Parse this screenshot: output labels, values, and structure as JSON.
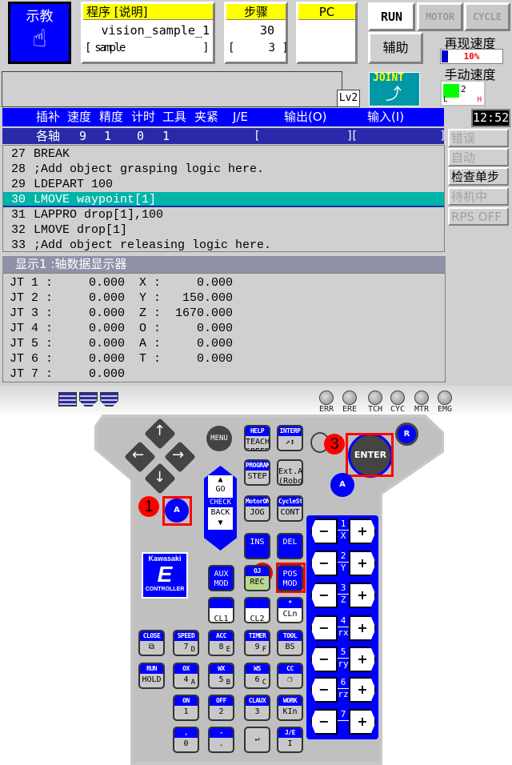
{
  "mode": {
    "label": "示教",
    "icon": "hand-pointer-icon"
  },
  "program": {
    "header": "程序 [说明]",
    "name": "vision_sample_1",
    "comment": "[ sample                ]"
  },
  "step": {
    "header": "步骤",
    "value": "30",
    "sub": "[     3 ]"
  },
  "pc": {
    "header": "PC",
    "value": ""
  },
  "status_buttons": [
    "RUN",
    "MOTOR",
    "CYCLE"
  ],
  "aux_label": "辅助",
  "repeat_speed": {
    "label": "再现速度",
    "value": "10%",
    "percent": 10
  },
  "manual_speed": {
    "label": "手动速度",
    "level": "2",
    "low": "L",
    "high": "H"
  },
  "level": "Lv2",
  "interp_mode": "JOINT",
  "clock": "12:52",
  "header_bar": [
    "插补",
    "速度",
    "精度",
    "计时",
    "工具",
    "夹紧",
    "J/E",
    "输出(O)",
    "输入(I)"
  ],
  "axis_bar": {
    "label": "各轴",
    "values": [
      "9",
      "1",
      "0",
      "1"
    ],
    "bracket": "[                    ][                   ]"
  },
  "program_lines": [
    {
      "num": "27",
      "text": "BREAK"
    },
    {
      "num": "28",
      "text": ";Add object grasping logic here."
    },
    {
      "num": "29",
      "text": "LDEPART 100"
    },
    {
      "num": "30",
      "text": "LMOVE waypoint[1]"
    },
    {
      "num": "31",
      "text": "LAPPRO drop[1],100"
    },
    {
      "num": "32",
      "text": "LMOVE drop[1]"
    },
    {
      "num": "33",
      "text": ";Add object releasing logic here."
    }
  ],
  "selected_line": "30",
  "side_status": [
    {
      "label": "错误",
      "active": false
    },
    {
      "label": "自动",
      "active": false
    },
    {
      "label": "检查单步",
      "active": true
    },
    {
      "label": "待机中",
      "active": false
    },
    {
      "label": "RPS OFF",
      "active": false
    }
  ],
  "display": {
    "title": "显示1 :轴数据显示器",
    "rows": [
      "JT 1 :     0.000  X :     0.000",
      "JT 2 :     0.000  Y :   150.000",
      "JT 3 :     0.000  Z :  1670.000",
      "JT 4 :     0.000  O :     0.000",
      "JT 5 :     0.000  A :     0.000",
      "JT 6 :     0.000  T :     0.000",
      "JT 7 :     0.000"
    ]
  },
  "lights": [
    "ERR",
    "ERE",
    "TCH",
    "CYC",
    "MTR",
    "EMG"
  ],
  "pendant": {
    "menu": "MENU",
    "go": "GO",
    "check": "CHECK",
    "back": "BACK",
    "enter": "ENTER",
    "r": "R",
    "a": "A",
    "logo": {
      "brand": "Kawasaki",
      "letter": "E",
      "sub": "CONTROLLER"
    },
    "keys": [
      {
        "top": "HELP",
        "main": "TEACH SPEED"
      },
      {
        "top": "INTERP",
        "main": "↗↕"
      },
      {
        "top": "PROGRAM",
        "main": "STEP"
      },
      {
        "top": "",
        "main": "Ext.Axis (Robot)"
      },
      {
        "top": "MotorON",
        "main": "JOG"
      },
      {
        "top": "CycleStart",
        "main": "CONT"
      },
      {
        "top": "",
        "main": "INS"
      },
      {
        "top": "",
        "main": "DEL"
      },
      {
        "top": "",
        "main": "AUX MOD"
      },
      {
        "top": "OJ",
        "main": "REC"
      },
      {
        "top": "",
        "main": "POS MOD"
      },
      {
        "top": "",
        "main": "CL1"
      },
      {
        "top": "",
        "main": "CL2"
      },
      {
        "top": "*",
        "main": "CLn"
      },
      {
        "top": "CLOSE",
        "main": "⧉"
      },
      {
        "top": "SPEED",
        "main": "7",
        "sub": "D"
      },
      {
        "top": "ACC",
        "main": "8",
        "sub": "E"
      },
      {
        "top": "TIMER",
        "main": "9",
        "sub": "F"
      },
      {
        "top": "TOOL",
        "main": "BS"
      },
      {
        "top": "RUN",
        "main": "HOLD"
      },
      {
        "top": "OX",
        "main": "4",
        "sub": "A"
      },
      {
        "top": "WX",
        "main": "5",
        "sub": "B"
      },
      {
        "top": "WS",
        "main": "6",
        "sub": "C"
      },
      {
        "top": "CC",
        "main": "❐"
      },
      {
        "top": "ON",
        "main": "1"
      },
      {
        "top": "OFF",
        "main": "2"
      },
      {
        "top": "CLAUX",
        "main": "3"
      },
      {
        "top": "WORK",
        "main": "KIn"
      },
      {
        "top": ",",
        "main": "0"
      },
      {
        "top": "-",
        "main": "."
      },
      {
        "top": "",
        "main": "↵"
      },
      {
        "top": "J/E",
        "main": "I"
      }
    ],
    "axes": [
      {
        "num": "1",
        "name": "X"
      },
      {
        "num": "2",
        "name": "Y"
      },
      {
        "num": "3",
        "name": "Z"
      },
      {
        "num": "4",
        "name": "rx"
      },
      {
        "num": "5",
        "name": "ry"
      },
      {
        "num": "6",
        "name": "rz"
      },
      {
        "num": "7",
        "name": ""
      }
    ],
    "minus": "−",
    "plus": "+"
  },
  "annotations": [
    "1",
    "2",
    "3"
  ],
  "colors": {
    "screen_bg": "#d0d0d0",
    "blue": "#0000ff",
    "highlight": "#00b4a8",
    "yellow": "#ffff00",
    "annotation": "#ff0000"
  }
}
